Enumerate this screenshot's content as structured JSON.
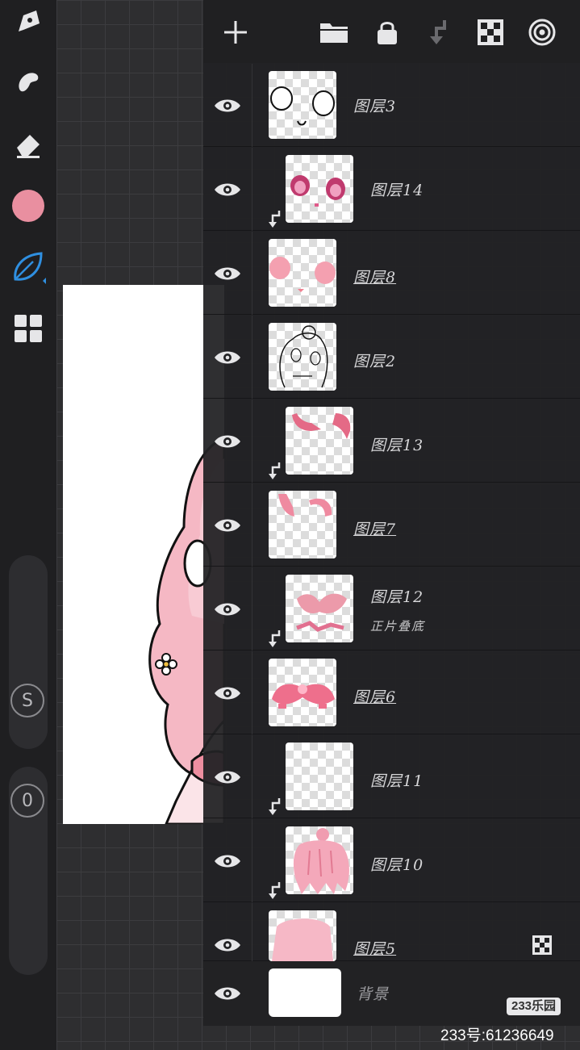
{
  "colors": {
    "current_color": "#e98fa0",
    "accent": "#2f8fe0",
    "panel_bg": "#222224",
    "toolbar_bg": "#1f1f21"
  },
  "toolbar": {
    "tools": [
      "pen-icon",
      "smudge-icon",
      "eraser-icon",
      "color-swatch",
      "leaf-brush-icon",
      "grid-menu-icon"
    ],
    "size_slider_label": "S",
    "opacity_slider_label": "0"
  },
  "layers_header": {
    "buttons": [
      "add-layer-icon",
      "folder-icon",
      "lock-icon",
      "merge-down-icon",
      "transparency-icon",
      "target-icon"
    ]
  },
  "layers": [
    {
      "name": "图层3",
      "clipped": false,
      "underlined": false,
      "visible": true
    },
    {
      "name": "图层14",
      "clipped": true,
      "underlined": false,
      "visible": true
    },
    {
      "name": "图层8",
      "clipped": false,
      "underlined": true,
      "visible": true
    },
    {
      "name": "图层2",
      "clipped": false,
      "underlined": false,
      "visible": true
    },
    {
      "name": "图层13",
      "clipped": true,
      "underlined": false,
      "visible": true
    },
    {
      "name": "图层7",
      "clipped": false,
      "underlined": true,
      "visible": true
    },
    {
      "name": "图层12",
      "clipped": true,
      "underlined": false,
      "visible": true,
      "blend_mode": "正片叠底"
    },
    {
      "name": "图层6",
      "clipped": false,
      "underlined": true,
      "visible": true
    },
    {
      "name": "图层11",
      "clipped": true,
      "underlined": false,
      "visible": true
    },
    {
      "name": "图层10",
      "clipped": true,
      "underlined": false,
      "visible": true
    },
    {
      "name": "图层5",
      "clipped": false,
      "underlined": true,
      "visible": true,
      "alpha_locked": true
    }
  ],
  "background_layer": {
    "name": "背景",
    "visible": true
  },
  "watermark": {
    "logo": "233乐园",
    "id_text": "233号:61236649"
  }
}
